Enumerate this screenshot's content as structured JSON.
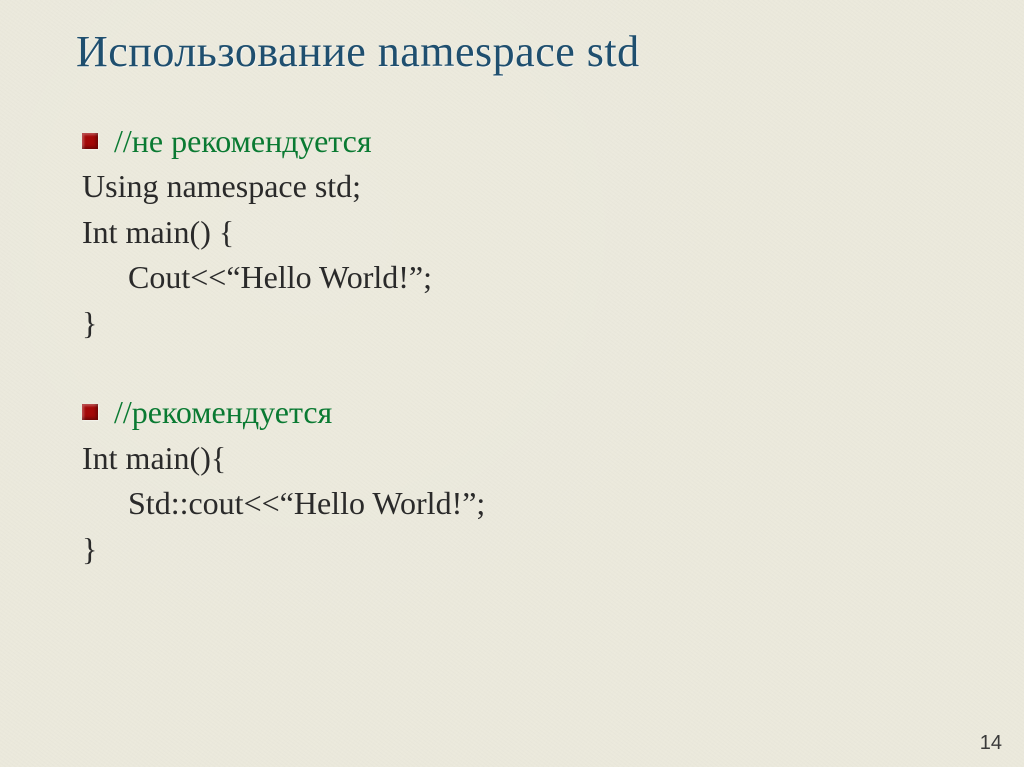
{
  "title": "Использование namespace std",
  "section1": {
    "comment": "//не рекомендуется",
    "line1": "Using namespace std;",
    "line2": "Int main()     {",
    "line3": "Cout<<“Hello World!”;",
    "line4": "}"
  },
  "section2": {
    "comment": "//рекомендуется",
    "line1": "Int main(){",
    "line2": "Std::cout<<“Hello World!”;",
    "line3": "}"
  },
  "page_number": "14"
}
